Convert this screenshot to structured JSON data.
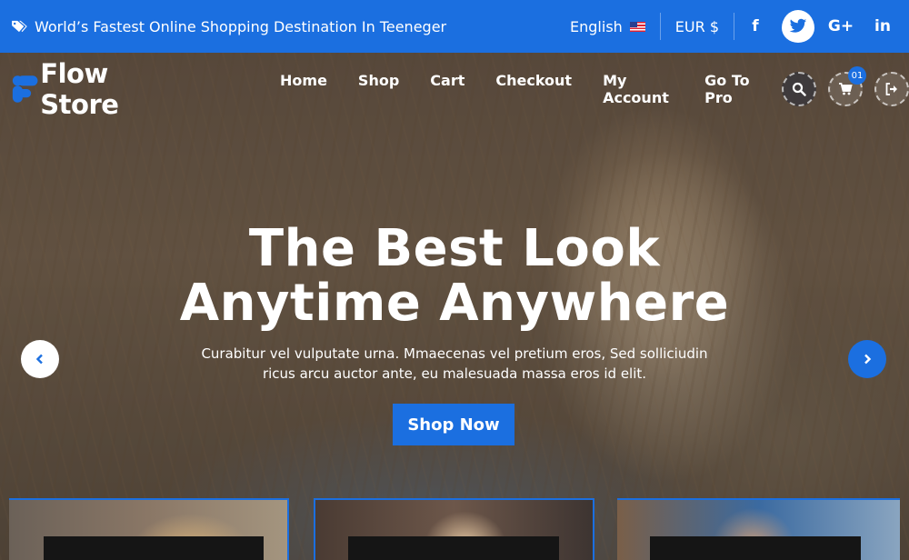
{
  "topbar": {
    "tagline": "World’s Fastest Online Shopping Destination In Teeneger",
    "language": "English",
    "currency": "EUR $",
    "social": {
      "facebook": "f",
      "twitter": "twitter-icon",
      "googleplus": "G+",
      "linkedin": "in"
    }
  },
  "nav": {
    "logo": "Flow Store",
    "menu": [
      "Home",
      "Shop",
      "Cart",
      "Checkout",
      "My Account",
      "Go To Pro"
    ],
    "cart_count": "01"
  },
  "hero": {
    "title_line1": "The Best Look",
    "title_line2": "Anytime Anywhere",
    "subtitle_line1": "Curabitur vel vulputate urna. Mmaecenas vel pretium eros, Sed solliciudin",
    "subtitle_line2": "ricus arcu auctor ante, eu malesuada massa eros id elit.",
    "button": "Shop Now"
  },
  "colors": {
    "accent": "#1b6fe0",
    "text_light": "#ffffff"
  }
}
